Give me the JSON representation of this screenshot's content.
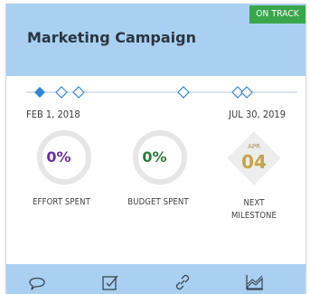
{
  "card": {
    "title": "Marketing Campaign",
    "status": "ON TRACK",
    "colors": {
      "header": "#a9d0f0",
      "status_badge": "#3aa64b",
      "timeline": "#2f86d6",
      "effort_value": "#6b2fa3",
      "budget_value": "#2c7b3c",
      "milestone_day": "#c8a245"
    }
  },
  "timeline": {
    "start_date": "FEB 1, 2018",
    "end_date": "JUL 30, 2019"
  },
  "stats": {
    "effort": {
      "value": "0%",
      "label": "EFFORT SPENT"
    },
    "budget": {
      "value": "0%",
      "label": "BUDGET SPENT"
    },
    "milestone": {
      "month": "APR",
      "day": "04",
      "label_line1": "NEXT",
      "label_line2": "MILESTONE"
    }
  },
  "footer": {
    "icons": [
      "comment-icon",
      "checkbox-icon",
      "link-icon",
      "area-chart-icon"
    ]
  }
}
